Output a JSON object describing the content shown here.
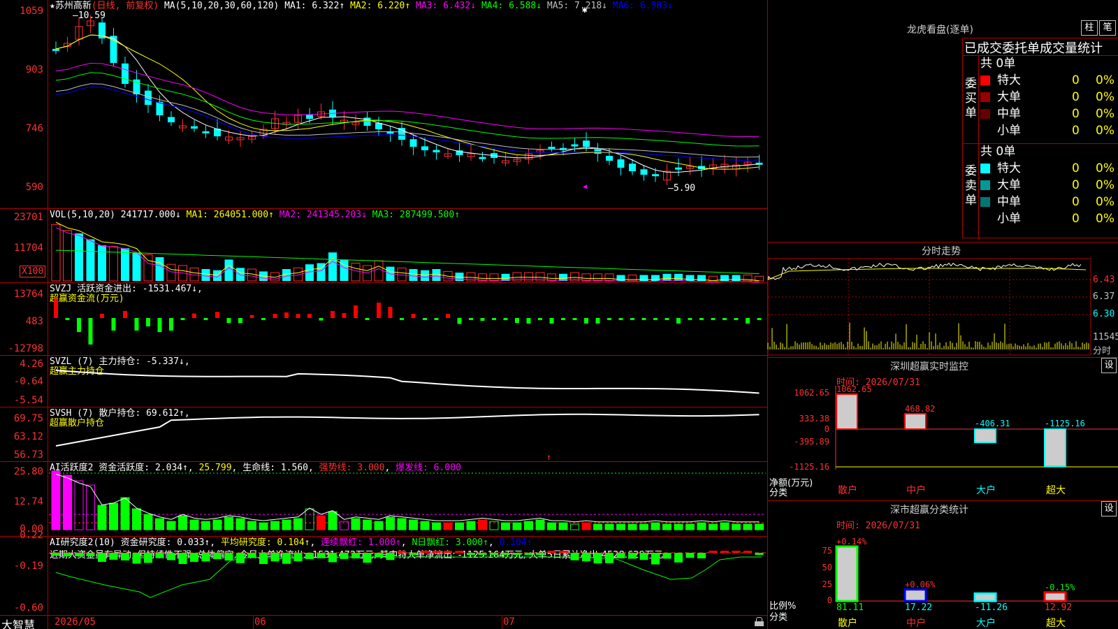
{
  "main_chart": {
    "star_marker": "★",
    "stock_name": "苏州高新",
    "period": "(日线, 前复权)",
    "ma_label": "MA(5,10,20,30,60,120)",
    "ma1": "MA1: 6.322↑",
    "ma2": "MA2: 6.220↑",
    "ma3": "MA3: 6.432↓",
    "ma4": "MA4: 6.588↓",
    "ma5": "MA5: 7.218↓",
    "ma6": "MA6: 6.983↓",
    "high_note": "—10.59",
    "low_note": "—5.90",
    "y_ticks": [
      "1059",
      "903",
      "746",
      "590"
    ],
    "colors": {
      "ma1": "#ffffff",
      "ma2": "#ffff00",
      "ma3": "#ff00ff",
      "ma4": "#00ff00",
      "ma5": "#c0c0c0",
      "ma6": "#0000ff"
    }
  },
  "vol_panel": {
    "label": "VOL(5,10,20)",
    "val": "241717.000↓",
    "ma1": "MA1: 264051.000↑",
    "ma2": "MA2: 241345.203↓",
    "ma3": "MA3: 287499.500↑",
    "y_ticks": [
      "23701",
      "11704"
    ],
    "unit": "X100"
  },
  "svzj_panel": {
    "label": "SVZJ  活跃资金进出: -1531.467↓,",
    "sub": "超赢资金流(万元)",
    "y_ticks": [
      "13764",
      "483",
      "-12798"
    ]
  },
  "svzl_panel": {
    "label": "SVZL (7) 主力持仓: -5.337↓,",
    "sub": "超赢主力持仓",
    "y_ticks": [
      "4.26",
      "-0.64",
      "-5.54"
    ]
  },
  "svsh_panel": {
    "label": "SVSH (7) 散户持仓: 69.612↑,",
    "sub": "超赢散户持仓",
    "y_ticks": [
      "69.75",
      "63.12",
      "56.73"
    ]
  },
  "ai_active_panel": {
    "label": "AI活跃度2 资金活跃度: 2.034↑",
    "v2": "25.799",
    "life": "生命线: 1.560",
    "strong": "强势线: 3.000",
    "burst": "爆发线: 6.000",
    "y_ticks": [
      "25.80",
      "12.74",
      "0.00"
    ]
  },
  "ai_research_panel": {
    "label": "AI研究度2(10) 资金研究度: 0.033↑",
    "avg": "平均研究度: 0.104↑",
    "cont": "连续飘红: 1.000↑",
    "n_day": "N日飘红: 3.000↑",
    "last": "0.104↑",
    "comment": "近期大资金虽有异动, 但持续性不强, 总体偏空, 今日大单净流出: -1531.473万元, 其中特大单净流出: -1125.164万元, 大单5日累计净出-4528.629万元",
    "y_ticks": [
      "0.22",
      "-0.19",
      "-0.60"
    ]
  },
  "x_axis": {
    "brand": "大智慧",
    "labels": [
      "2026/05",
      "06",
      "07"
    ]
  },
  "right_panel": {
    "lhb_title": "龙虎看盘(逐单)",
    "btn_col": "柱",
    "btn_pen": "笔",
    "section_title": "已成交委托单成交量统计",
    "buy_label": "委买单",
    "sell_label": "委卖单",
    "buy_total": "共 0单",
    "sell_total": "共 0单",
    "buy_rows": [
      {
        "name": "特大",
        "count": "0",
        "pct": "0%",
        "color": "#ff0000"
      },
      {
        "name": "大单",
        "count": "0",
        "pct": "0%",
        "color": "#990000"
      },
      {
        "name": "中单",
        "count": "0",
        "pct": "0%",
        "color": "#660000"
      },
      {
        "name": "小单",
        "count": "0",
        "pct": "0%",
        "color": "#000000"
      }
    ],
    "sell_rows": [
      {
        "name": "特大",
        "count": "0",
        "pct": "0%",
        "color": "#00ffff"
      },
      {
        "name": "大单",
        "count": "0",
        "pct": "0%",
        "color": "#009999"
      },
      {
        "name": "中单",
        "count": "0",
        "pct": "0%",
        "color": "#007777"
      },
      {
        "name": "小单",
        "count": "0",
        "pct": "0%",
        "color": "#000000"
      }
    ],
    "intraday_title": "分时走势",
    "intraday_ticks": [
      "6.43",
      "6.37",
      "6.30",
      "11545",
      "分时"
    ],
    "sz_title": "深圳超赢实时监控",
    "sz_btn": "设",
    "sz_time": "时间: 2026/07/31",
    "sz_ticks": [
      "1062.65",
      "333.38",
      "0",
      "-395.89",
      "-1125.16"
    ],
    "sz_net": "净额(万元)",
    "sz_cat": "分类",
    "sz_bars": [
      {
        "name": "散户",
        "value": "1062.65"
      },
      {
        "name": "中户",
        "value": "468.82"
      },
      {
        "name": "大户",
        "value": "-406.31"
      },
      {
        "name": "超大",
        "value": "-1125.16"
      }
    ],
    "cls_title": "深市超赢分类统计",
    "cls_btn": "设",
    "cls_time": "时间: 2026/07/31",
    "cls_ticks": [
      "75",
      "50",
      "25",
      "0"
    ],
    "cls_ratio": "比例%",
    "cls_cat": "分类",
    "cls_bars": [
      {
        "name": "散户",
        "pct": "+0.14%",
        "value": "81.11"
      },
      {
        "name": "中户",
        "pct": "+0.06%",
        "value": "17.22"
      },
      {
        "name": "大户",
        "pct": "",
        "value": "-11.26"
      },
      {
        "name": "超大",
        "pct": "-0.15%",
        "value": "12.92"
      }
    ]
  }
}
